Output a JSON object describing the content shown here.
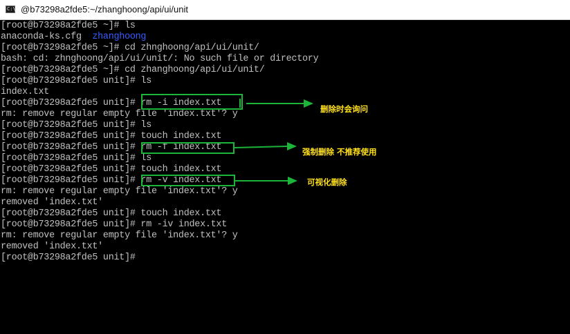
{
  "window": {
    "icon_label": "C:\\",
    "title": "@b73298a2fde5:~/zhanghoong/api/ui/unit"
  },
  "terminal": {
    "lines": [
      {
        "text": "[root@b73298a2fde5 ~]# ls"
      },
      {
        "text": "anaconda-ks.cfg  ",
        "dir": "zhanghoong"
      },
      {
        "text": "[root@b73298a2fde5 ~]# cd zhnghoong/api/ui/unit/"
      },
      {
        "text": "bash: cd: zhnghoong/api/ui/unit/: No such file or directory"
      },
      {
        "text": "[root@b73298a2fde5 ~]# cd zhanghoong/api/ui/unit/"
      },
      {
        "text": "[root@b73298a2fde5 unit]# ls"
      },
      {
        "text": "index.txt"
      },
      {
        "text": "[root@b73298a2fde5 unit]# rm -i index.txt"
      },
      {
        "text": "rm: remove regular empty file 'index.txt'? y"
      },
      {
        "text": "[root@b73298a2fde5 unit]# ls"
      },
      {
        "text": "[root@b73298a2fde5 unit]# touch index.txt"
      },
      {
        "text": "[root@b73298a2fde5 unit]# rm -f index.txt"
      },
      {
        "text": "[root@b73298a2fde5 unit]# ls"
      },
      {
        "text": "[root@b73298a2fde5 unit]# touch index.txt"
      },
      {
        "text": "[root@b73298a2fde5 unit]# rm -v index.txt"
      },
      {
        "text": "rm: remove regular empty file 'index.txt'? y"
      },
      {
        "text": "removed 'index.txt'"
      },
      {
        "text": "[root@b73298a2fde5 unit]# touch index.txt"
      },
      {
        "text": "[root@b73298a2fde5 unit]# rm -iv index.txt"
      },
      {
        "text": "rm: remove regular empty file 'index.txt'? y"
      },
      {
        "text": "removed 'index.txt'"
      },
      {
        "text": "[root@b73298a2fde5 unit]#"
      }
    ]
  },
  "annotations": {
    "note_rm_i": "删除时会询问",
    "note_rm_f": "强制删除 不推荐使用",
    "note_rm_v": "可视化删除",
    "color": "#1db43a",
    "text_color": "#ffe01a"
  },
  "colors": {
    "background": "#000000",
    "text": "#c0c0c0",
    "directory": "#3b5bff"
  }
}
